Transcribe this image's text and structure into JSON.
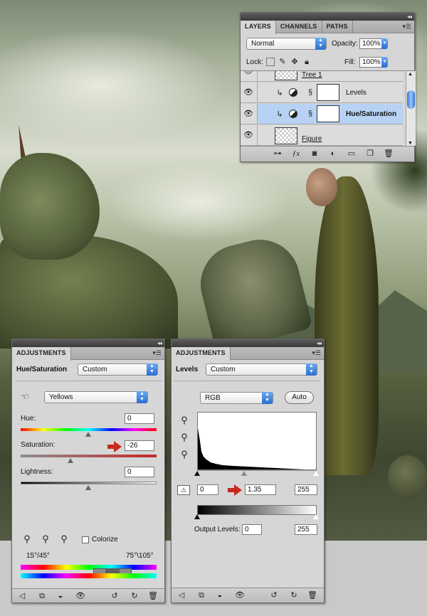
{
  "layers_panel": {
    "tabs": [
      "LAYERS",
      "CHANNELS",
      "PATHS"
    ],
    "blend_mode": "Normal",
    "opacity_label": "Opacity:",
    "opacity_value": "100%",
    "lock_label": "Lock:",
    "fill_label": "Fill:",
    "fill_value": "100%",
    "layers": [
      {
        "name": "Tree 1",
        "selected": false
      },
      {
        "name": "Levels",
        "selected": false
      },
      {
        "name": "Hue/Saturation",
        "selected": true
      },
      {
        "name": "Figure",
        "selected": false
      }
    ]
  },
  "hue_sat_panel": {
    "tab": "ADJUSTMENTS",
    "title": "Hue/Saturation",
    "preset": "Custom",
    "channel": "Yellows",
    "hue_label": "Hue:",
    "hue_value": "0",
    "saturation_label": "Saturation:",
    "saturation_value": "-26",
    "lightness_label": "Lightness:",
    "lightness_value": "0",
    "colorize_label": "Colorize",
    "range_left": "15°/45°",
    "range_right": "75°\\105°"
  },
  "levels_panel": {
    "tab": "ADJUSTMENTS",
    "title": "Levels",
    "preset": "Custom",
    "channel": "RGB",
    "auto_label": "Auto",
    "input_black": "0",
    "input_mid": "1.35",
    "input_white": "255",
    "output_label": "Output Levels:",
    "output_black": "0",
    "output_white": "255"
  },
  "colors": {
    "selection": "#b7d2f3",
    "annotation_arrow": "#c8281e",
    "panel_bg": "#d6d6d6"
  }
}
